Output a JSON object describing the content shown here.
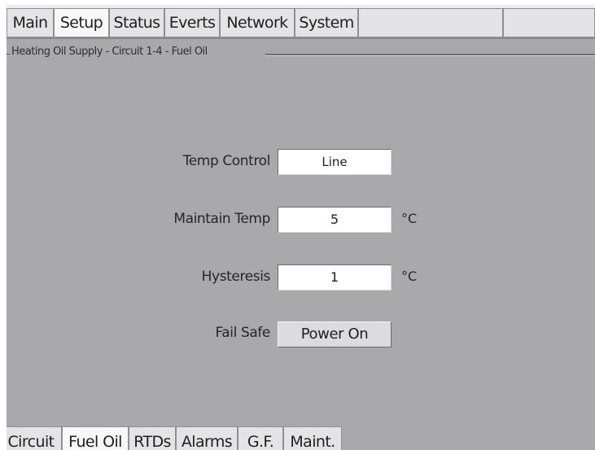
{
  "top_tabs": [
    {
      "label": "Main"
    },
    {
      "label": "Setup",
      "active": true
    },
    {
      "label": "Status"
    },
    {
      "label": "Everts"
    },
    {
      "label": "Network"
    },
    {
      "label": "System"
    }
  ],
  "group": {
    "title": "Heating Oil Supply - Circuit 1-4 - Fuel Oil"
  },
  "form": {
    "temp_control": {
      "label": "Temp Control",
      "value": "Line"
    },
    "maintain_temp": {
      "label": "Maintain Temp",
      "value": "5",
      "unit": "°C"
    },
    "hysteresis": {
      "label": "Hysteresis",
      "value": "1",
      "unit": "°C"
    },
    "fail_safe": {
      "label": "Fail Safe",
      "value": "Power On"
    }
  },
  "bottom_tabs": [
    {
      "label": "Circuit"
    },
    {
      "label": "Fuel Oil",
      "active": true
    },
    {
      "label": "RTDs"
    },
    {
      "label": "Alarms"
    },
    {
      "label": "G.F."
    },
    {
      "label": "Maint."
    }
  ]
}
